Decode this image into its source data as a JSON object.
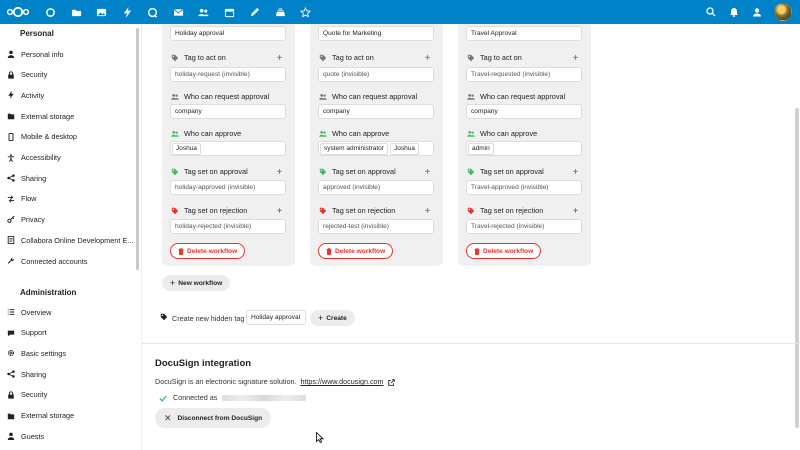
{
  "colors": {
    "brand": "#0082c9",
    "danger": "#e9322d",
    "success": "#46ba61"
  },
  "header": {
    "apps": [
      "dashboard-icon",
      "files-icon",
      "photos-icon",
      "activity-icon",
      "talk-icon",
      "mail-icon",
      "contacts-icon",
      "calendar-icon",
      "notes-icon",
      "deck-icon",
      "tasks-icon"
    ],
    "right": [
      "search-icon",
      "notifications-icon",
      "contacts-menu-icon"
    ]
  },
  "sidebar": {
    "personal_title": "Personal",
    "personal_items": [
      {
        "label": "Personal info",
        "icon": "user-icon"
      },
      {
        "label": "Security",
        "icon": "lock-icon"
      },
      {
        "label": "Activity",
        "icon": "activity-icon"
      },
      {
        "label": "External storage",
        "icon": "storage-icon"
      },
      {
        "label": "Mobile & desktop",
        "icon": "phone-icon"
      },
      {
        "label": "Accessibility",
        "icon": "accessibility-icon"
      },
      {
        "label": "Sharing",
        "icon": "share-icon"
      },
      {
        "label": "Flow",
        "icon": "flow-icon"
      },
      {
        "label": "Privacy",
        "icon": "key-icon"
      },
      {
        "label": "Collabora Online Development E...",
        "icon": "collabora-icon"
      },
      {
        "label": "Connected accounts",
        "icon": "wrench-icon"
      }
    ],
    "admin_title": "Administration",
    "admin_items": [
      {
        "label": "Overview",
        "icon": "list-icon"
      },
      {
        "label": "Support",
        "icon": "chat-icon"
      },
      {
        "label": "Basic settings",
        "icon": "gear-icon"
      },
      {
        "label": "Sharing",
        "icon": "share-icon"
      },
      {
        "label": "Security",
        "icon": "lock-icon"
      },
      {
        "label": "External storage",
        "icon": "storage-icon"
      },
      {
        "label": "Guests",
        "icon": "user-icon"
      }
    ]
  },
  "labels": {
    "tag_to_act_on": "Tag to act on",
    "who_can_request": "Who can request approval",
    "who_can_approve": "Who can approve",
    "tag_set_on_approval": "Tag set on approval",
    "tag_set_on_rejection": "Tag set on rejection",
    "delete_workflow": "Delete workflow"
  },
  "workflows": [
    {
      "title": "Holiday approval",
      "tag_to_act_on": "holiday-request (invisible)",
      "requesters": [
        "company"
      ],
      "approvers": [
        "Joshua"
      ],
      "approval_tag": "holiday-approved (invisible)",
      "rejection_tag": "holiday-rejected (invisible)"
    },
    {
      "title": "Quote for Marketing",
      "tag_to_act_on": "quote (invisible)",
      "requesters": [
        "company"
      ],
      "approvers": [
        "system administrator",
        "Joshua"
      ],
      "approval_tag": "approved (invisible)",
      "rejection_tag": "rejected-test (invisible)"
    },
    {
      "title": "Travel Approval",
      "tag_to_act_on": "Travel-requested (invisible)",
      "requesters": [
        "company"
      ],
      "approvers": [
        "admin"
      ],
      "approval_tag": "Travel-approved (invisible)",
      "rejection_tag": "Travel-rejected (invisible)"
    }
  ],
  "new_workflow_label": "New workflow",
  "hidden_tag": {
    "label": "Create new hidden tag",
    "value": "Holiday approval",
    "create_label": "Create"
  },
  "docusign": {
    "title": "DocuSign integration",
    "description": "DocuSign is an electronic signature solution.",
    "link": "https://www.docusign.com",
    "connected_label": "Connected as",
    "disconnect_label": "Disconnect from DocuSign"
  }
}
